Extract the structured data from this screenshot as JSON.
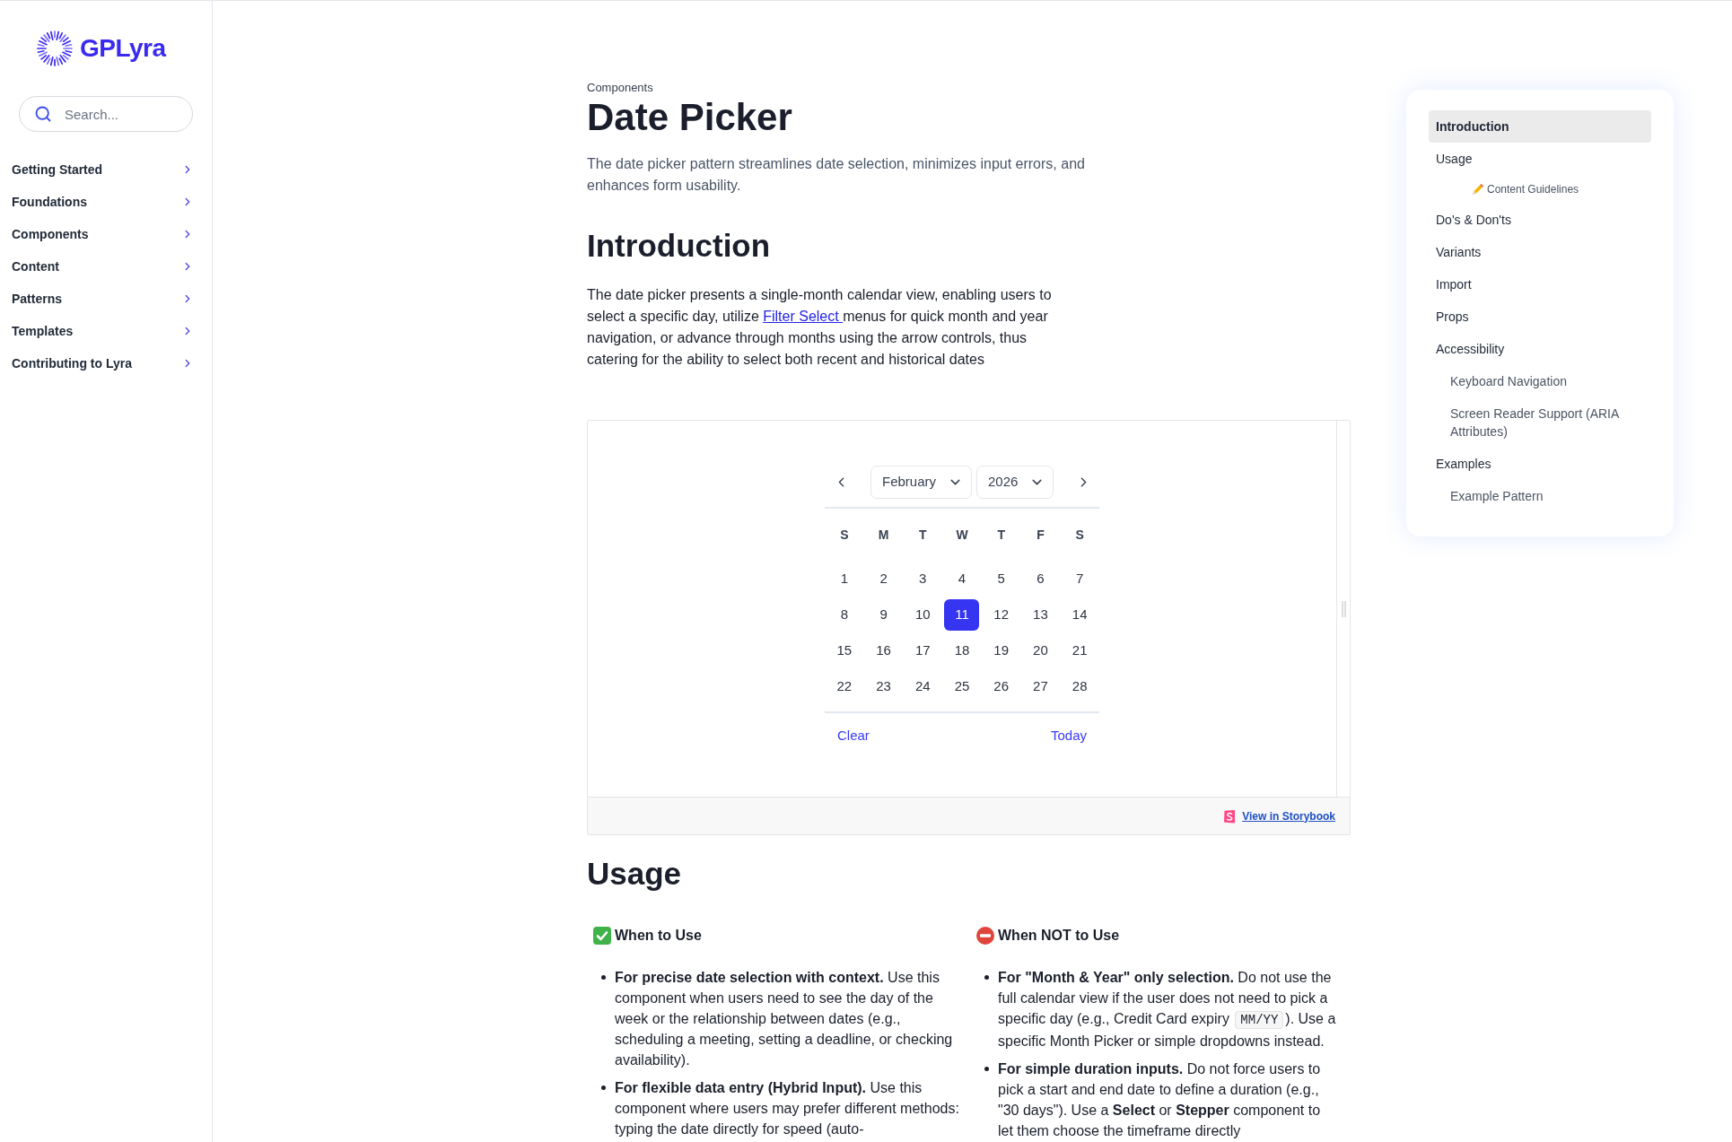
{
  "sidebar": {
    "logo": "GPLyra",
    "search": {
      "placeholder": "Search..."
    },
    "nav_items": [
      {
        "label": "Getting Started",
        "expanded": false
      },
      {
        "label": "Foundations",
        "expanded": false
      },
      {
        "label": "Components",
        "expanded": false
      },
      {
        "label": "Content",
        "expanded": false
      },
      {
        "label": "Patterns",
        "expanded": false
      },
      {
        "label": "Templates",
        "expanded": false
      },
      {
        "label": "Contributing to Lyra",
        "expanded": false
      }
    ]
  },
  "page": {
    "breadcrumb": "Components",
    "title": "Date Picker",
    "description": "The date picker pattern streamlines date selection, minimizes input errors, and enhances form usability."
  },
  "introduction": {
    "heading": "Introduction",
    "paragraph": [
      {
        "kind": "text",
        "text": "The date picker presents a single-month calendar view, enabling users to select a specific day, utilize "
      },
      {
        "kind": "link",
        "text": "Filter Select "
      },
      {
        "kind": "text",
        "text": "menus for quick month and year navigation, or advance through months using the arrow controls, thus catering for the ability to select both recent and historical dates"
      }
    ]
  },
  "demo": {
    "month": "February",
    "year": "2026",
    "weekdays": [
      "S",
      "M",
      "T",
      "W",
      "T",
      "F",
      "S"
    ],
    "weeks": [
      [
        {
          "label": "1",
          "selected": false
        },
        {
          "label": "2",
          "selected": false
        },
        {
          "label": "3",
          "selected": false
        },
        {
          "label": "4",
          "selected": false
        },
        {
          "label": "5",
          "selected": false
        },
        {
          "label": "6",
          "selected": false
        },
        {
          "label": "7",
          "selected": false
        }
      ],
      [
        {
          "label": "8",
          "selected": false
        },
        {
          "label": "9",
          "selected": false
        },
        {
          "label": "10",
          "selected": false
        },
        {
          "label": "11",
          "selected": true
        },
        {
          "label": "12",
          "selected": false
        },
        {
          "label": "13",
          "selected": false
        },
        {
          "label": "14",
          "selected": false
        }
      ],
      [
        {
          "label": "15",
          "selected": false
        },
        {
          "label": "16",
          "selected": false
        },
        {
          "label": "17",
          "selected": false
        },
        {
          "label": "18",
          "selected": false
        },
        {
          "label": "19",
          "selected": false
        },
        {
          "label": "20",
          "selected": false
        },
        {
          "label": "21",
          "selected": false
        }
      ],
      [
        {
          "label": "22",
          "selected": false
        },
        {
          "label": "23",
          "selected": false
        },
        {
          "label": "24",
          "selected": false
        },
        {
          "label": "25",
          "selected": false
        },
        {
          "label": "26",
          "selected": false
        },
        {
          "label": "27",
          "selected": false
        },
        {
          "label": "28",
          "selected": false
        }
      ]
    ],
    "actions": [
      "Clear",
      "Today"
    ],
    "storybook_link": "View in Storybook"
  },
  "usage": {
    "heading": "Usage",
    "columns": [
      {
        "kind": "do",
        "heading": "When to Use",
        "items": [
          [
            {
              "kind": "text",
              "text": "**For precise date selection with context.** Use this component when users need to see the day of the week or the relationship between dates (e.g., scheduling a meeting, setting a deadline, or checking availability)."
            }
          ],
          [
            {
              "kind": "text",
              "text": "**For flexible data entry (Hybrid Input).** Use this component where users may prefer different methods: typing the date directly for speed (auto-"
            }
          ]
        ]
      },
      {
        "kind": "dont",
        "heading": "When NOT to Use",
        "items": [
          [
            {
              "kind": "text",
              "text": "**For \"Month & Year\" only selection.** Do not use the full calendar view if the user does not need to pick a specific day (e.g., Credit Card expiry "
            },
            {
              "kind": "code",
              "text": "MM/YY"
            },
            {
              "kind": "text",
              "text": "). Use a specific Month Picker or simple dropdowns instead."
            }
          ],
          [
            {
              "kind": "text",
              "text": "**For simple duration inputs.** Do not force users to pick a start and end date to define a duration (e.g., \"30 days\"). Use a **Select** or **Stepper** component to let them choose the timeframe directly"
            }
          ]
        ]
      }
    ]
  },
  "toc": [
    {
      "label": "Introduction",
      "selected": true
    },
    {
      "label": "Usage",
      "selected": false,
      "children": [
        {
          "kind": "note",
          "label": "Content Guidelines",
          "selected": false
        }
      ]
    },
    {
      "label": "Do's & Don'ts",
      "selected": false
    },
    {
      "label": "Variants",
      "selected": false
    },
    {
      "label": "Import",
      "selected": false
    },
    {
      "label": "Props",
      "selected": false
    },
    {
      "label": "Accessibility",
      "selected": false,
      "children": [
        {
          "kind": "section",
          "label": "Keyboard Navigation",
          "selected": false
        },
        {
          "kind": "section",
          "label": "Screen Reader Support (ARIA Attributes)",
          "selected": false
        }
      ]
    },
    {
      "label": "Examples",
      "selected": false,
      "children": [
        {
          "kind": "section",
          "label": "Example Pattern",
          "selected": false
        }
      ]
    }
  ]
}
